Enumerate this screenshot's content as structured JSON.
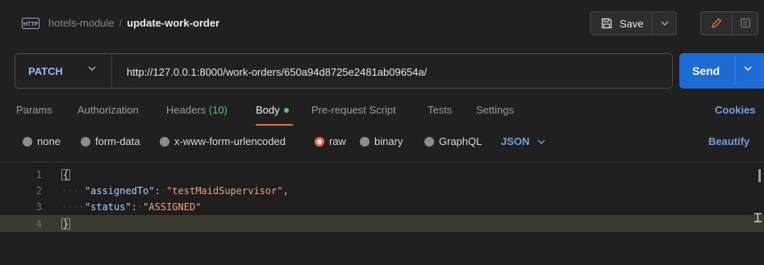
{
  "header": {
    "collection": "hotels-module",
    "separator": "/",
    "request_name": "update-work-order",
    "save_label": "Save"
  },
  "request": {
    "method": "PATCH",
    "url": "http://127.0.0.1:8000/work-orders/650a94d8725e2481ab09654a/",
    "send_label": "Send"
  },
  "tabs": [
    {
      "label": "Params"
    },
    {
      "label": "Authorization"
    },
    {
      "label": "Headers",
      "count": "(10)"
    },
    {
      "label": "Body",
      "active": true
    },
    {
      "label": "Pre-request Script"
    },
    {
      "label": "Tests"
    },
    {
      "label": "Settings"
    }
  ],
  "cookies_label": "Cookies",
  "body_types": [
    {
      "label": "none"
    },
    {
      "label": "form-data"
    },
    {
      "label": "x-www-form-urlencoded"
    },
    {
      "label": "raw",
      "checked": true
    },
    {
      "label": "binary"
    },
    {
      "label": "GraphQL"
    }
  ],
  "format_select": "JSON",
  "beautify_label": "Beautify",
  "editor": {
    "line_numbers": [
      "1",
      "2",
      "3",
      "4"
    ],
    "open_brace": "{",
    "close_brace": "}",
    "key1": "\"assignedTo\"",
    "val1": "\"testMaidSupervisor\"",
    "key2": "\"status\"",
    "val2": "\"ASSIGNED\""
  },
  "colors": {
    "accent": "#f26b3a",
    "send": "#1f6ad3",
    "link": "#6f9ee6",
    "method": "#9db8f0",
    "count": "#5bc46c"
  },
  "icons": {
    "http": "http-icon",
    "save": "save-icon",
    "edit": "pencil-icon",
    "comment": "comment-icon"
  }
}
